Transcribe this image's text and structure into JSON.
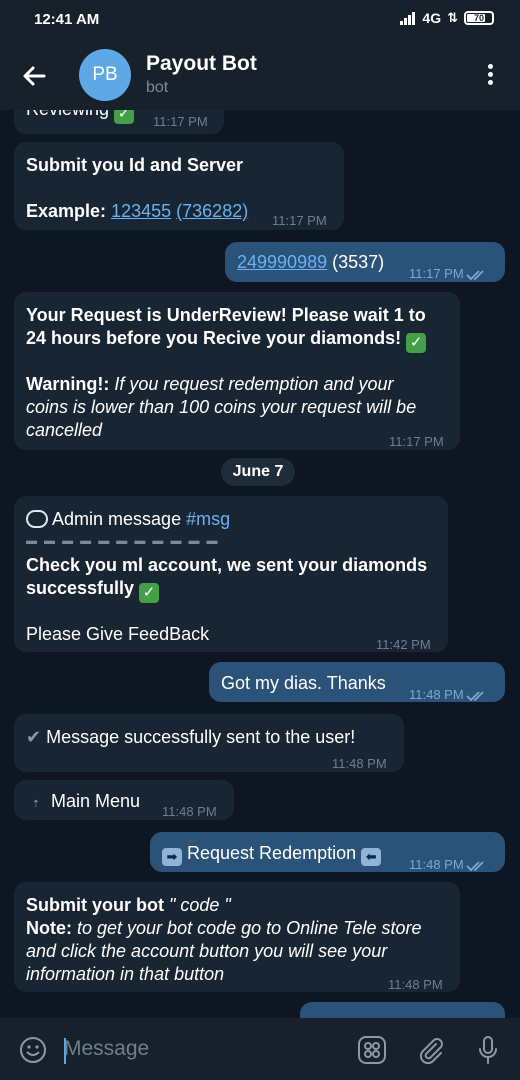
{
  "status_bar": {
    "time": "12:41 AM",
    "network": "4G",
    "battery": "70"
  },
  "header": {
    "avatar_initials": "PB",
    "title": "Payout Bot",
    "subtitle": "bot"
  },
  "messages": {
    "m1": {
      "text": "Reviewing",
      "time": "11:17 PM"
    },
    "m2": {
      "line1": "Submit you Id and Server",
      "example_label": "Example:",
      "id_link": "123455",
      "server_link": "(736282)",
      "time": "11:17 PM"
    },
    "m3": {
      "id_link": "249990989",
      "server": "(3537)",
      "time": "11:17 PM"
    },
    "m4": {
      "line1": "Your Request is UnderReview! Please wait 1 to",
      "line2": "24 hours before you Recive your diamonds!",
      "warning_label": "Warning!:",
      "warning_1": "If you request redemption and your",
      "warning_2": "coins is lower than 100 coins your request will be",
      "warning_3": "cancelled",
      "time": "11:17 PM"
    },
    "date_divider": "June 7",
    "m5": {
      "admin_label": "Admin message",
      "hashtag": "#msg",
      "line1": "Check you ml account, we sent your diamonds",
      "line2": "successfully",
      "line3": "Please Give FeedBack",
      "time": "11:42 PM"
    },
    "m6": {
      "text": "Got my dias. Thanks",
      "time": "11:48 PM"
    },
    "m7": {
      "text": "Message successfully sent to the user!",
      "time": "11:48 PM"
    },
    "m8": {
      "text": "Main Menu",
      "time": "11:48 PM"
    },
    "m9": {
      "text": "Request Redemption",
      "time": "11:48 PM"
    },
    "m10": {
      "line1_bold": "Submit  your bot",
      "line1_italic": " \" code \"",
      "note_label": "Note:",
      "note_1": " to get your bot code go to Online Tele store",
      "note_2": "and click the account button you will see your",
      "note_3": "information in that button",
      "time": "11:48 PM"
    }
  },
  "input": {
    "placeholder": "Message"
  },
  "colors": {
    "background": "#0e1621",
    "header": "#17212b",
    "incoming": "#182533",
    "outgoing": "#2b5278",
    "link": "#6ab2f2",
    "avatar": "#5fa8e6"
  }
}
